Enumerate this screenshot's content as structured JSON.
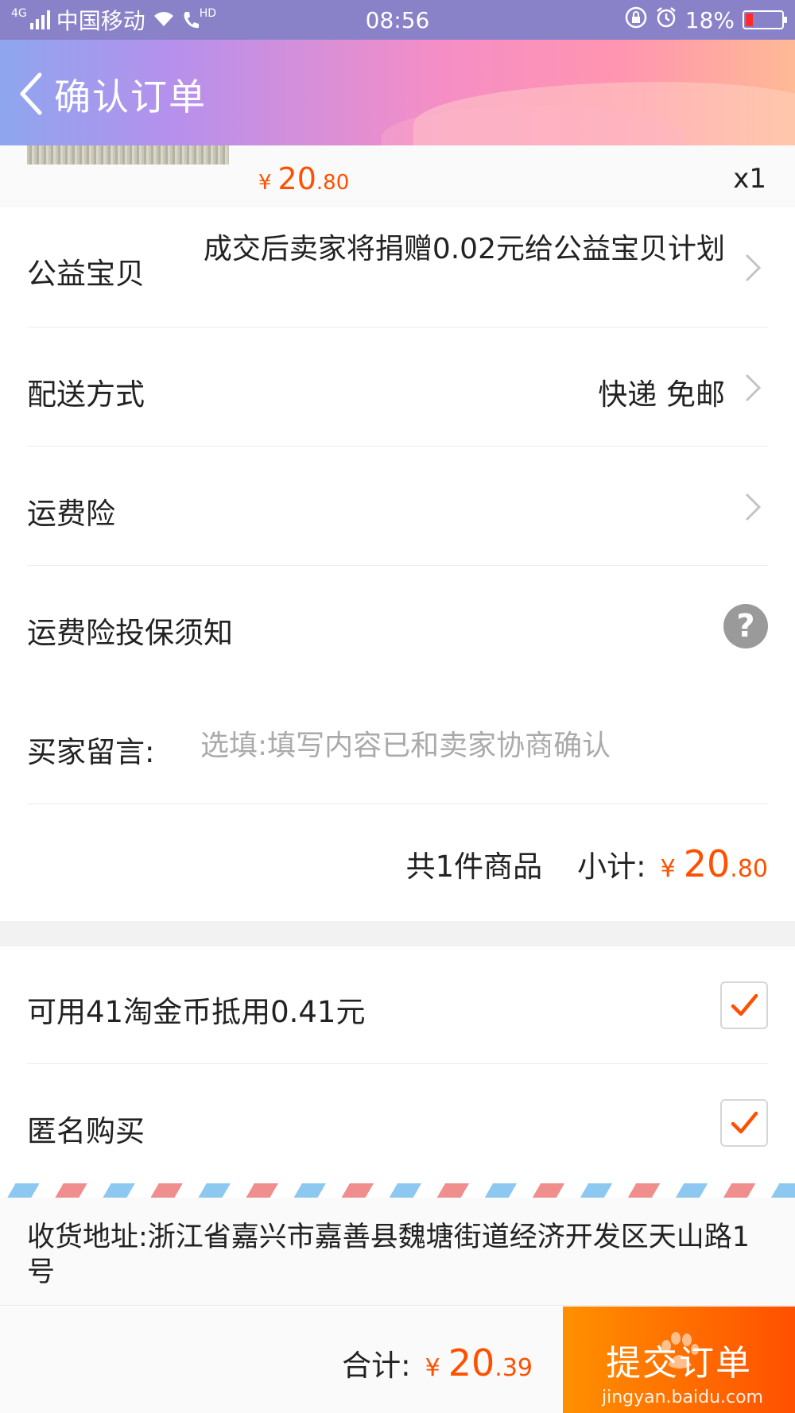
{
  "status_bar": {
    "network_tag": "4G",
    "carrier": "中国移动",
    "hd_tag": "HD",
    "time": "08:56",
    "battery_percent": "18%",
    "battery_level": 0.18
  },
  "header": {
    "title": "确认订单"
  },
  "product": {
    "price_yen": "¥",
    "price_int": "20",
    "price_dec": ".80",
    "quantity": "x1"
  },
  "charity": {
    "label": "公益宝贝",
    "value": "成交后卖家将捐赠0.02元给公益宝贝计划"
  },
  "delivery": {
    "label": "配送方式",
    "value": "快递 免邮"
  },
  "insurance": {
    "label": "运费险"
  },
  "insurance_notice": {
    "label": "运费险投保须知",
    "help_symbol": "?"
  },
  "message": {
    "label": "买家留言:",
    "placeholder": "选填:填写内容已和卖家协商确认"
  },
  "subtotal": {
    "count_text": "共1件商品",
    "label": "小计:",
    "yen": "¥",
    "int": "20",
    "dec": ".80"
  },
  "coins": {
    "label": "可用41淘金币抵用0.41元",
    "checked": true
  },
  "anonymous": {
    "label": "匿名购买",
    "checked": true
  },
  "address": {
    "text": "收货地址:浙江省嘉兴市嘉善县魏塘街道经济开发区天山路1号"
  },
  "footer": {
    "total_label": "合计:",
    "yen": "¥",
    "int": "20",
    "dec": ".39",
    "submit_label": "提交订单",
    "watermark": "jingyan.baidu.com"
  },
  "colors": {
    "accent": "#ff5000",
    "submit_start": "#ff9000",
    "submit_end": "#ff5000",
    "status_bar": "#8a82c8"
  }
}
